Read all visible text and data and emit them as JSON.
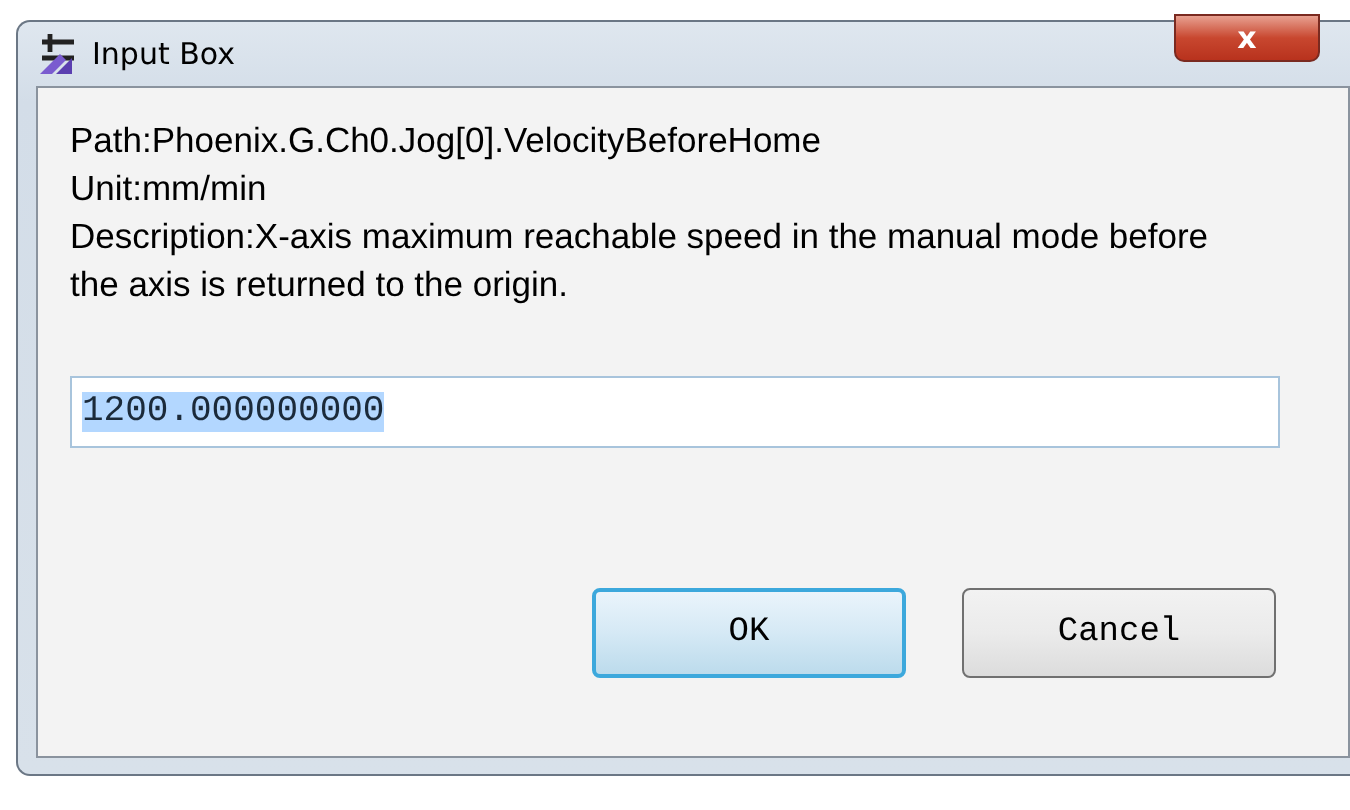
{
  "window": {
    "title": "Input Box",
    "close": "x"
  },
  "lines": [
    "Path:Phoenix.G.Ch0.Jog[0].VelocityBeforeHome",
    "Unit:mm/min",
    "Description:X-axis maximum reachable speed in the manual mode before the axis is returned to the origin."
  ],
  "field": {
    "value": "1200.000000000",
    "selected": true
  },
  "buttons": [
    {
      "label": "OK",
      "default": true
    },
    {
      "label": "Cancel",
      "default": false
    }
  ]
}
